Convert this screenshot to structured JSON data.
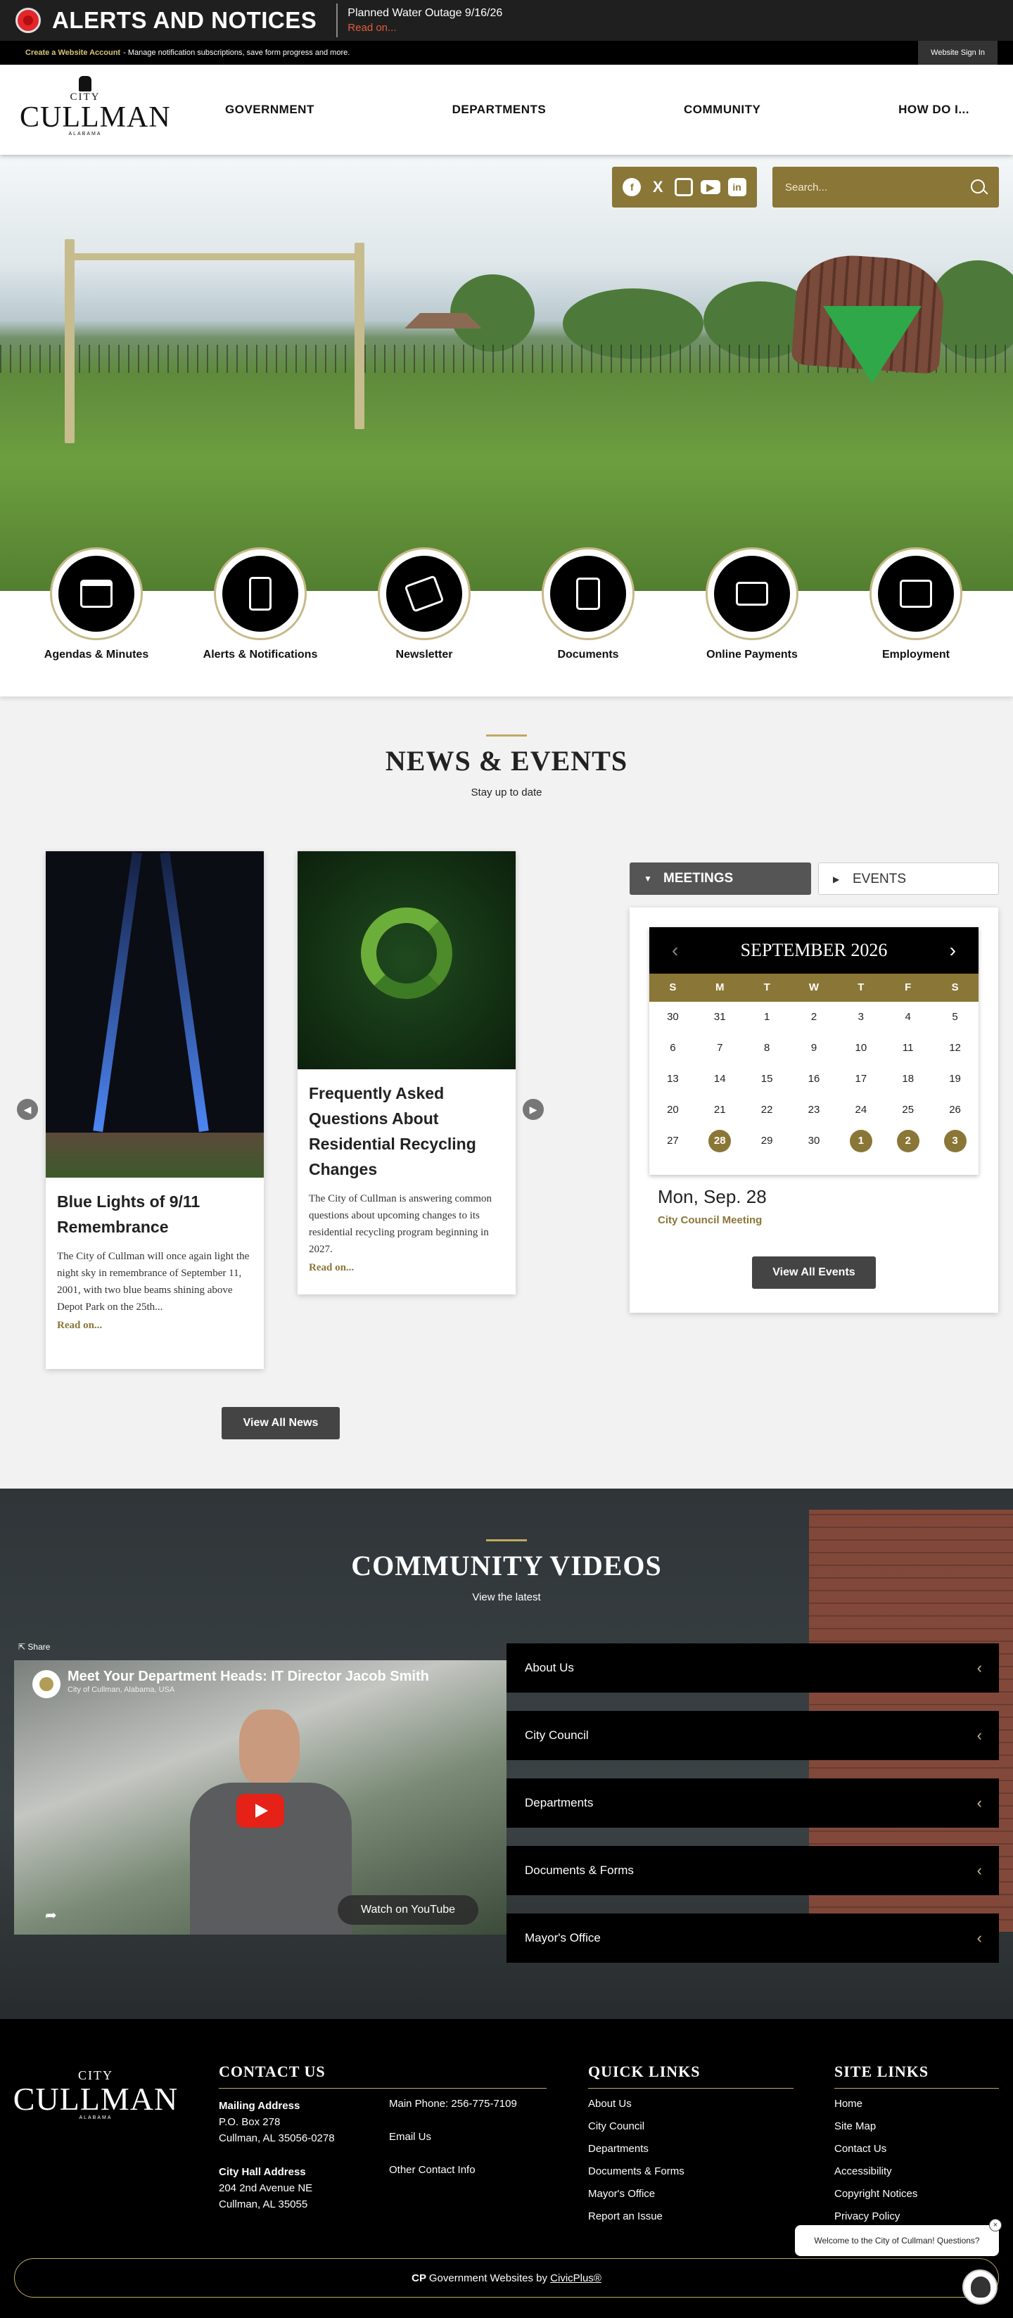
{
  "alert": {
    "title": "ALERTS AND NOTICES",
    "notice": "Planned Water Outage 9/16/26",
    "read_on": "Read on..."
  },
  "util": {
    "create_account": "Create a Website Account",
    "description": "- Manage notification subscriptions, save form progress and more.",
    "sign_in": "Website Sign In"
  },
  "logo": {
    "city": "CITY",
    "name": "CULLMAN",
    "state": "ALABAMA"
  },
  "nav": [
    "GOVERNMENT",
    "DEPARTMENTS",
    "COMMUNITY",
    "HOW DO I..."
  ],
  "social": {
    "icons": [
      "facebook-icon",
      "x-icon",
      "instagram-icon",
      "youtube-icon",
      "linkedin-icon"
    ]
  },
  "search": {
    "placeholder": "Search..."
  },
  "quick_links": [
    {
      "label": "Agendas & Minutes",
      "icon": "calendar-icon"
    },
    {
      "label": "Alerts & Notifications",
      "icon": "phone-alert-icon"
    },
    {
      "label": "Newsletter",
      "icon": "envelope-icon"
    },
    {
      "label": "Documents",
      "icon": "document-icon"
    },
    {
      "label": "Online Payments",
      "icon": "credit-card-icon"
    },
    {
      "label": "Employment",
      "icon": "briefcase-icon"
    }
  ],
  "news": {
    "title": "NEWS & EVENTS",
    "subtitle": "Stay up to date",
    "items": [
      {
        "title": "Blue Lights of 9/11 Remembrance",
        "body": "The City of Cullman will once again light the night sky in remembrance of September 11, 2001, with two blue beams shining above Depot Park on the 25th...",
        "read_on": "Read on..."
      },
      {
        "title": "Frequently Asked Questions About Residential Recycling Changes",
        "body": "The City of Cullman is answering common questions about upcoming changes to its residential recycling program beginning in 2027.",
        "read_on": "Read on..."
      }
    ],
    "view_all": "View All News"
  },
  "events": {
    "tabs": [
      "MEETINGS",
      "EVENTS"
    ],
    "calendar": {
      "month": "SEPTEMBER 2026",
      "dow": [
        "S",
        "M",
        "T",
        "W",
        "T",
        "F",
        "S"
      ],
      "days": [
        "30",
        "31",
        "1",
        "2",
        "3",
        "4",
        "5",
        "6",
        "7",
        "8",
        "9",
        "10",
        "11",
        "12",
        "13",
        "14",
        "15",
        "16",
        "17",
        "18",
        "19",
        "20",
        "21",
        "22",
        "23",
        "24",
        "25",
        "26",
        "27",
        "28",
        "29",
        "30",
        "1",
        "2",
        "3"
      ],
      "highlighted": [
        "28",
        "1",
        "2",
        "3"
      ]
    },
    "selected_date": "Mon, Sep. 28",
    "selected_event": "City Council Meeting",
    "view_all": "View All Events"
  },
  "videos": {
    "title": "COMMUNITY VIDEOS",
    "subtitle": "View the latest",
    "share": "Share",
    "video_title": "Meet Your Department Heads: IT Director Jacob Smith",
    "video_channel": "City of Cullman, Alabama, USA",
    "watch_on": "Watch on YouTube",
    "categories": [
      "About Us",
      "City Council",
      "Departments",
      "Documents & Forms",
      "Mayor's Office"
    ]
  },
  "footer": {
    "contact_title": "CONTACT US",
    "mailing_label": "Mailing Address",
    "mailing_lines": [
      "P.O. Box 278",
      "Cullman, AL  35056-0278"
    ],
    "hall_label": "City Hall Address",
    "hall_lines": [
      "204 2nd Avenue NE",
      "Cullman, AL  35055"
    ],
    "phone": "Main Phone: 256-775-7109",
    "email": "Email Us",
    "other_contact": "Other Contact Info",
    "quick_title": "QUICK LINKS",
    "quick_links": [
      "About Us",
      "City Council",
      "Departments",
      "Documents & Forms",
      "Mayor's Office",
      "Report an Issue"
    ],
    "site_title": "SITE LINKS",
    "site_links": [
      "Home",
      "Site Map",
      "Contact Us",
      "Accessibility",
      "Copyright Notices",
      "Privacy Policy"
    ],
    "powered_prefix": "Government Websites by",
    "powered_link": "CivicPlus®"
  },
  "chat": {
    "message": "Welcome to the City of Cullman! Questions?",
    "close": "×"
  },
  "colors": {
    "gold": "#8a7636",
    "gold_light": "#c2a860",
    "alert_red": "#e3262a",
    "dark": "#000000"
  }
}
